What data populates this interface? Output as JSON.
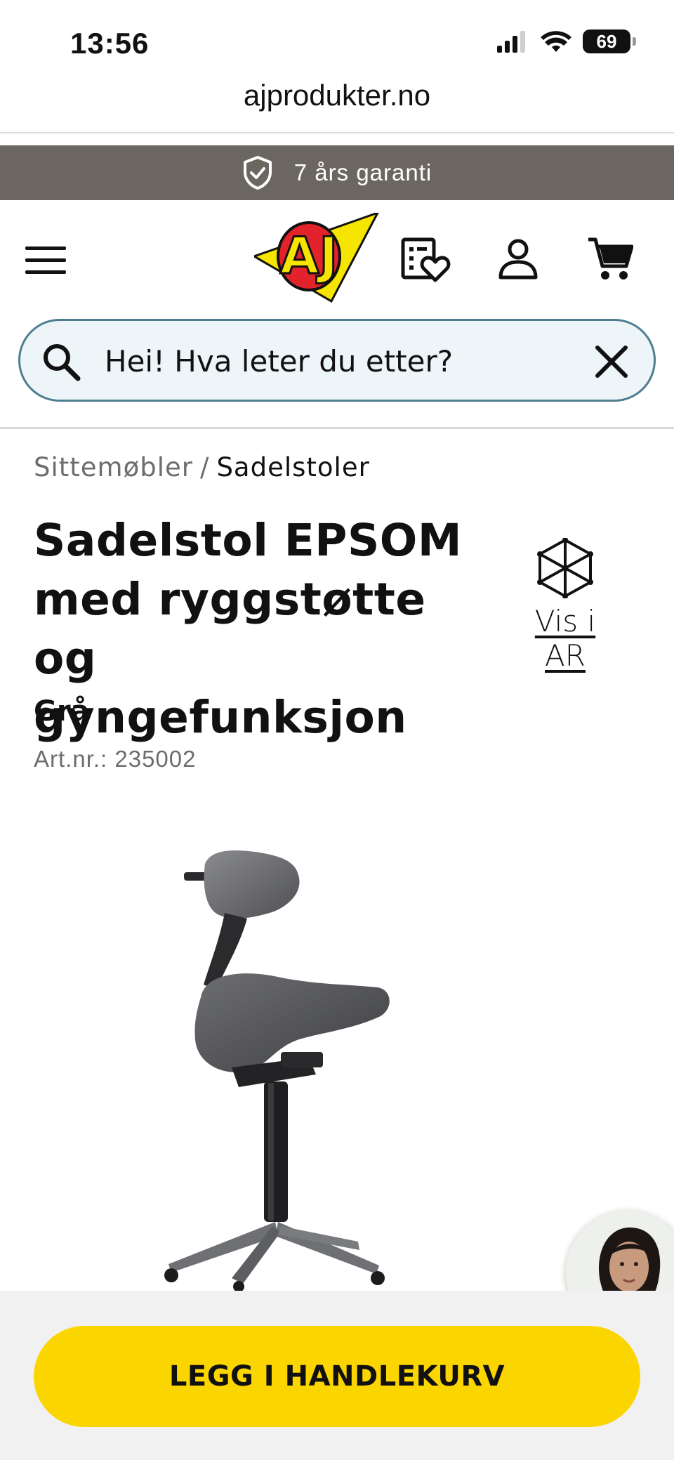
{
  "status_bar": {
    "time": "13:56",
    "battery": "69",
    "icons": [
      "signal-icon",
      "wifi-icon",
      "battery-icon"
    ]
  },
  "browser": {
    "url": "ajprodukter.no"
  },
  "banner": {
    "text": "7 års garanti",
    "icon": "shield-check-icon"
  },
  "header": {
    "icons": [
      "menu-icon",
      "aj-logo",
      "wishlist-icon",
      "account-icon",
      "cart-icon"
    ],
    "logo_text": "AJ"
  },
  "search": {
    "placeholder": "Hei! Hva leter du etter?",
    "value": ""
  },
  "breadcrumb": {
    "parent": "Sittemøbler",
    "separator": "/",
    "current": "Sadelstoler"
  },
  "product": {
    "title_line1": "Sadelstol EPSOM",
    "title_line2": "med ryggstøtte og",
    "title_line3": "gyngefunksjon",
    "variant": "Grå",
    "article_number": "Art.nr.: 235002"
  },
  "ar": {
    "label": "Vis i AR",
    "icon": "ar-cube-icon"
  },
  "actions": {
    "add_to_cart": "LEGG I HANDLEKURV"
  },
  "colors": {
    "banner_bg": "#6b6760",
    "search_border": "#4f7e90",
    "search_bg": "#edf5f9",
    "cta_bg": "#fbd500",
    "logo_red": "#e3232b",
    "logo_yellow": "#f6e500"
  }
}
